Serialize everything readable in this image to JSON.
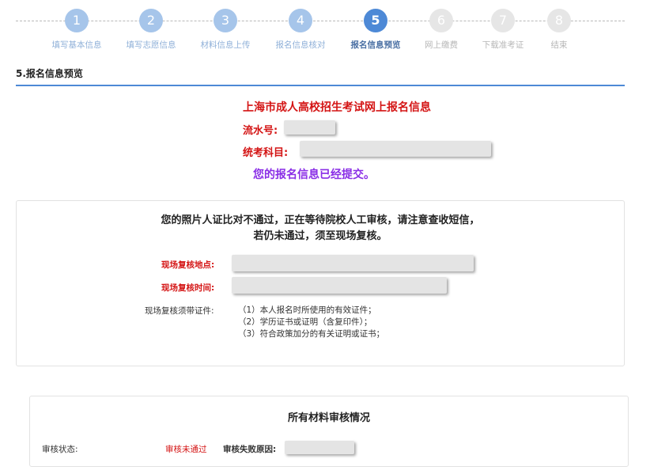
{
  "stepper": {
    "steps": [
      {
        "num": "1",
        "label": "填写基本信息",
        "state": "done"
      },
      {
        "num": "2",
        "label": "填写志愿信息",
        "state": "done"
      },
      {
        "num": "3",
        "label": "材料信息上传",
        "state": "done"
      },
      {
        "num": "4",
        "label": "报名信息核对",
        "state": "done"
      },
      {
        "num": "5",
        "label": "报名信息预览",
        "state": "active"
      },
      {
        "num": "6",
        "label": "网上缴费",
        "state": "todo"
      },
      {
        "num": "7",
        "label": "下载准考证",
        "state": "todo"
      },
      {
        "num": "8",
        "label": "结束",
        "state": "todo"
      }
    ]
  },
  "section": {
    "title": "5.报名信息预览"
  },
  "info": {
    "title": "上海市成人高校招生考试网上报名信息",
    "serial_label": "流水号:",
    "subject_label": "统考科目:",
    "submitted": "您的报名信息已经提交。"
  },
  "review": {
    "notice_line1": "您的照片人证比对不通过，正在等待院校人工审核，请注意查收短信，",
    "notice_line2": "若仍未通过，须至现场复核。",
    "location_label": "现场复核地点:",
    "time_label": "现场复核时间:",
    "docs_label": "现场复核须带证件:",
    "docs": [
      "（1）本人报名时所使用的有效证件；",
      "（2）学历证书或证明（含复印件）；",
      "（3）符合政策加分的有关证明或证书；"
    ]
  },
  "materials": {
    "title": "所有材料审核情况",
    "status_label": "审核状态:",
    "status_value": "审核未通过",
    "reason_label": "审核失败原因:"
  },
  "colors": {
    "accent": "#4d89d6",
    "done": "#a6c5ea",
    "todo": "#e6e6e6",
    "red": "#d41414",
    "purple": "#8a2ee6"
  }
}
